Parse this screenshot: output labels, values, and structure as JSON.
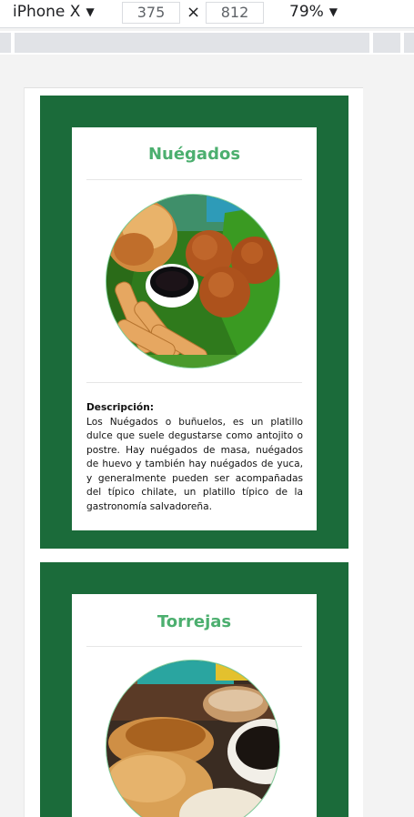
{
  "toolbar": {
    "device_name": "iPhone X",
    "width": "375",
    "height": "812",
    "zoom": "79%"
  },
  "cards": [
    {
      "title": "Nuégados",
      "desc_label": "Descripción:",
      "desc_text": "Los Nuégados o buñuelos, es un platillo dulce que suele degustarse como antojito o postre. Hay nuégados de masa, nuégados de huevo y también hay nuégados de yuca, y generalmente pueden ser acompañadas del típico chilate, un platillo típico de la gastronomía salvadoreña."
    },
    {
      "title": "Torrejas"
    }
  ],
  "colors": {
    "card_green": "#1b6b3a",
    "title_green": "#4caf6f"
  }
}
